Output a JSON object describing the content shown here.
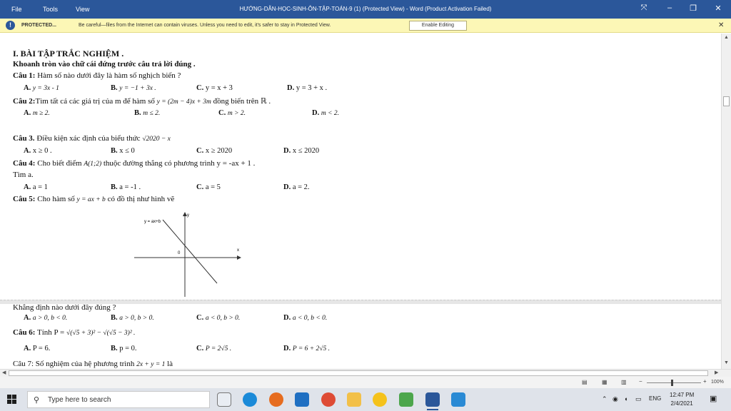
{
  "window": {
    "menu": [
      "File",
      "Tools",
      "View"
    ],
    "title": "HƯỚNG-DẪN-HỌC-SINH-ÔN-TẬP-TOÁN-9 (1) (Protected View) - Word (Product Activation Failed)"
  },
  "protected_bar": {
    "label": "PROTECTED...",
    "message": "Be careful—files from the Internet can contain viruses. Unless you need to edit, it's safer to stay in Protected View.",
    "button": "Enable Editing"
  },
  "doc": {
    "heading": "I. BÀI TẬP TRẮC NGHIỆM .",
    "instruction": "Khoanh tròn vào chữ cái đứng trước câu trả lời đúng .",
    "q1": {
      "label": "Câu 1:",
      "text": " Hàm số nào dưới đây là hàm số nghịch biến ?",
      "a": [
        "A.",
        "y = 3x - 1"
      ],
      "b": [
        "B.",
        "y = −1 + 3x ."
      ],
      "c": [
        "C.",
        "y = x + 3"
      ],
      "d": [
        "D.",
        "y = 3 + x ."
      ]
    },
    "q2": {
      "label": "Câu 2:",
      "text": "Tìm tất cả các giá trị của m để hàm số",
      "formula": "y = (2m − 4)x + 3m",
      "tail": "đồng biến trên ℝ .",
      "a": [
        "A.",
        "m ≥ 2."
      ],
      "b": [
        "B.",
        "m ≤ 2."
      ],
      "c": [
        "C.",
        "m > 2."
      ],
      "d": [
        "D.",
        "m < 2."
      ]
    },
    "q3": {
      "label": "Câu 3.",
      "text": " Điều kiện xác định của biểu thức",
      "formula": "√2020 − x",
      "a": [
        "A.",
        "x ≥ 0 ."
      ],
      "b": [
        "B.",
        "x ≤ 0"
      ],
      "c": [
        "C.",
        "x ≥ 2020"
      ],
      "d": [
        "D.",
        "x ≤ 2020"
      ]
    },
    "q4": {
      "label": "Câu 4:",
      "text": " Cho biết điểm",
      "formula": "A(1;2)",
      "tail": "thuộc đường thẳng có phương trình y = -ax + 1 .",
      "line2": "Tìm a.",
      "a": [
        "A.",
        "a = 1"
      ],
      "b": [
        "B.",
        "a = -1 ."
      ],
      "c": [
        "C.",
        "a = 5"
      ],
      "d": [
        "D.",
        "a = 2."
      ]
    },
    "q5": {
      "label": "Câu 5:",
      "text": " Cho hàm số",
      "formula": "y = ax + b",
      "tail": "có đồ thị như hình vẽ",
      "graph": {
        "line_label": "y = ax+b",
        "x_label": "x",
        "y_label": "y",
        "origin": "0"
      },
      "question": "Khẳng định nào dưới đây đúng ?",
      "a": [
        "A.",
        "a > 0, b < 0."
      ],
      "b": [
        "B.",
        "a > 0, b > 0."
      ],
      "c": [
        "C.",
        "a < 0, b > 0."
      ],
      "d": [
        "D.",
        "a < 0, b < 0."
      ]
    },
    "q6": {
      "label": "Câu 6:",
      "text": " Tính P = ",
      "formula": "√(√5 + 3)² − √(√5 − 3)² .",
      "a": [
        "A.",
        "P = 6."
      ],
      "b": [
        "B.",
        "p = 0."
      ],
      "c": [
        "C.",
        "P = 2√5 ."
      ],
      "d": [
        "D.",
        "P = 6 + 2√5 ."
      ]
    },
    "q7": {
      "text": "Câu 7: Số nghiệm của hệ phương trình",
      "formula": "2x + y = 1",
      "tail": "là"
    }
  },
  "status": {
    "zoom": "100%"
  },
  "taskbar": {
    "search_placeholder": "Type here to search",
    "lang": "ENG",
    "time": "12:47 PM",
    "date": "2/4/2021"
  },
  "colors": {
    "titlebar": "#2b579a",
    "protected_bar": "#fcf7b6",
    "taskbar": "#dfe3ea"
  }
}
